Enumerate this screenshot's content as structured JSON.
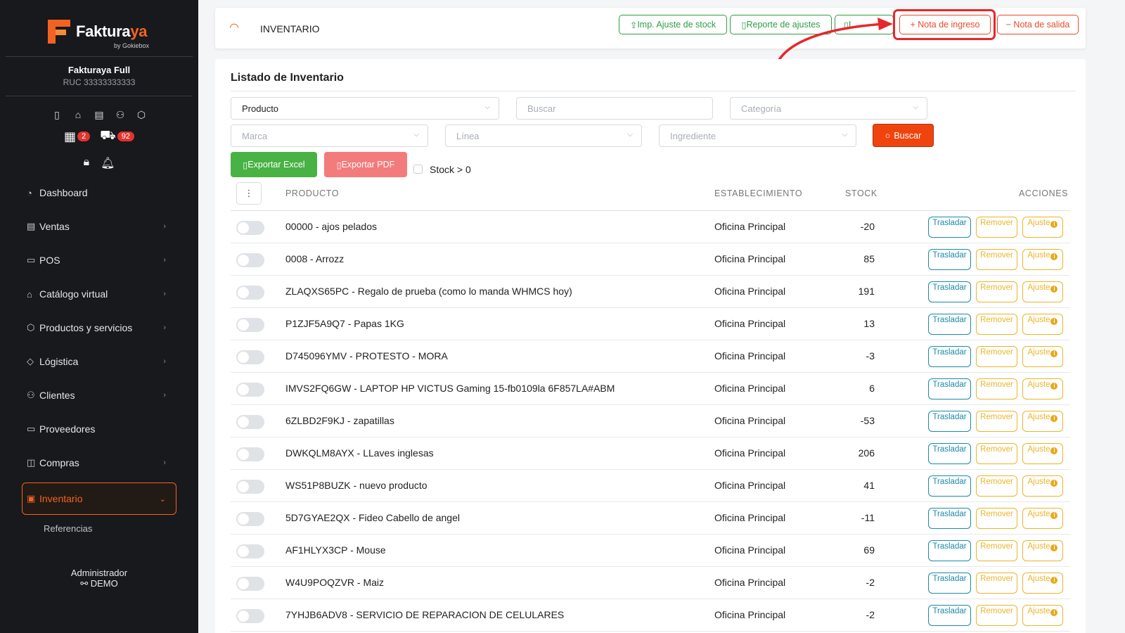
{
  "brand": {
    "name_main": "Faktura",
    "name_accent": "ya",
    "sub": "by Gokiebox"
  },
  "company": {
    "name": "Fakturaya Full",
    "ruc": "RUC 33333333333"
  },
  "badges": {
    "calendar_count": "2",
    "box_count": "92"
  },
  "menu": [
    {
      "label": "Dashboard",
      "icon": "dashboard-icon"
    },
    {
      "label": "Ventas",
      "icon": "ventas-icon"
    },
    {
      "label": "POS",
      "icon": "monitor-icon"
    },
    {
      "label": "Catálogo virtual",
      "icon": "store-icon"
    },
    {
      "label": "Productos y servicios",
      "icon": "cube-icon"
    },
    {
      "label": "Lógistica",
      "icon": "tag-icon"
    },
    {
      "label": "Clientes",
      "icon": "users-icon"
    },
    {
      "label": "Proveedores",
      "icon": "briefcase-icon"
    },
    {
      "label": "Compras",
      "icon": "bag-icon"
    },
    {
      "label": "Inventario",
      "icon": "inventory-icon"
    }
  ],
  "submenu": {
    "referencias": "Referencias"
  },
  "user": {
    "role": "Administrador",
    "name": "DEMO"
  },
  "topbar": {
    "title": "INVENTARIO",
    "btn_imp": "Imp. Ajuste de stock",
    "btn_reporte": "Reporte de ajustes",
    "btn_hidden": "I",
    "btn_ingreso": "+ Nota de ingreso",
    "btn_salida": "− Nota de salida"
  },
  "listado": {
    "title": "Listado de Inventario",
    "filter_tipo": "Producto",
    "search_placeholder": "Buscar",
    "categoria_placeholder": "Categoría",
    "marca_placeholder": "Marca",
    "linea_placeholder": "Línea",
    "ingrediente_placeholder": "Ingrediente",
    "btn_buscar": "Buscar",
    "btn_excel": "Exportar Excel",
    "btn_pdf": "Exportar PDF",
    "stock_filter_label": "Stock > 0"
  },
  "table": {
    "headers": {
      "producto": "PRODUCTO",
      "establecimiento": "ESTABLECIMIENTO",
      "stock": "STOCK",
      "acciones": "ACCIONES"
    },
    "actions": {
      "trasladar": "Trasladar",
      "remover": "Remover",
      "ajuste": "Ajuste"
    },
    "rows": [
      {
        "producto": "00000 - ajos pelados",
        "establecimiento": "Oficina Principal",
        "stock": "-20"
      },
      {
        "producto": "0008 - Arrozz",
        "establecimiento": "Oficina Principal",
        "stock": "85"
      },
      {
        "producto": "ZLAQXS65PC - Regalo de prueba (como lo manda WHMCS hoy)",
        "establecimiento": "Oficina Principal",
        "stock": "191"
      },
      {
        "producto": "P1ZJF5A9Q7 - Papas 1KG",
        "establecimiento": "Oficina Principal",
        "stock": "13"
      },
      {
        "producto": "D745096YMV - PROTESTO - MORA",
        "establecimiento": "Oficina Principal",
        "stock": "-3"
      },
      {
        "producto": "IMVS2FQ6GW - LAPTOP HP VICTUS Gaming 15-fb0109la 6F857LA#ABM",
        "establecimiento": "Oficina Principal",
        "stock": "6"
      },
      {
        "producto": "6ZLBD2F9KJ - zapatillas",
        "establecimiento": "Oficina Principal",
        "stock": "-53"
      },
      {
        "producto": "DWKQLM8AYX - LLaves inglesas",
        "establecimiento": "Oficina Principal",
        "stock": "206"
      },
      {
        "producto": "WS51P8BUZK - nuevo producto",
        "establecimiento": "Oficina Principal",
        "stock": "41"
      },
      {
        "producto": "5D7GYAE2QX - Fideo Cabello de angel",
        "establecimiento": "Oficina Principal",
        "stock": "-11"
      },
      {
        "producto": "AF1HLYX3CP - Mouse",
        "establecimiento": "Oficina Principal",
        "stock": "69"
      },
      {
        "producto": "W4U9POQZVR - Maiz",
        "establecimiento": "Oficina Principal",
        "stock": "-2"
      },
      {
        "producto": "7YHJB6ADV8 - SERVICIO DE REPARACION DE CELULARES",
        "establecimiento": "Oficina Principal",
        "stock": "-2"
      }
    ]
  },
  "colors": {
    "accent": "#f26322",
    "sidebar_bg": "#17191d",
    "highlight": "#e8262b",
    "green": "#2e9e44",
    "trasladar": "#1a8aa8",
    "remover": "#e9b52a"
  }
}
